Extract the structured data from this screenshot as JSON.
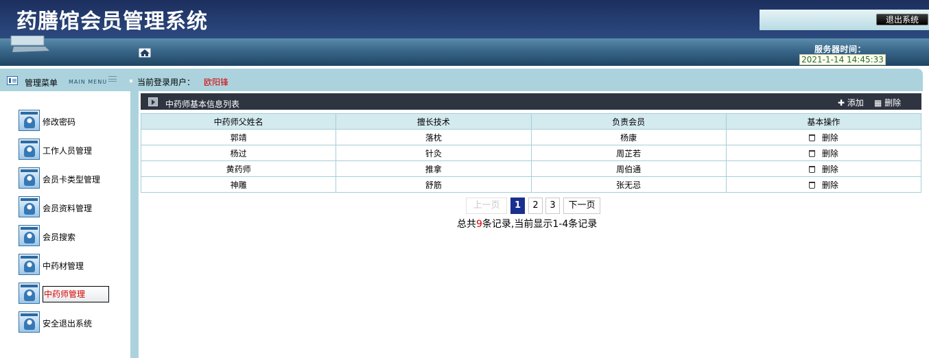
{
  "app": {
    "title": "药膳馆会员管理系统",
    "logout_label": "退出系统",
    "server_time_label": "服务器时间：",
    "server_time_value": "2021-1-14 14:45:33"
  },
  "menu_strip": {
    "title": "管理菜单",
    "subtitle": "MAIN MENU",
    "current_user_label": "当前登录用户：",
    "current_user_name": "欧阳锋"
  },
  "sidebar": {
    "items": [
      {
        "label": "修改密码"
      },
      {
        "label": "工作人员管理"
      },
      {
        "label": "会员卡类型管理"
      },
      {
        "label": "会员资料管理"
      },
      {
        "label": "会员搜索"
      },
      {
        "label": "中药材管理"
      },
      {
        "label": "中药师管理",
        "active": true
      },
      {
        "label": "安全退出系统"
      }
    ]
  },
  "panel": {
    "title": "中药师基本信息列表",
    "add_label": "✚ 添加",
    "delete_label": "▦ 删除"
  },
  "table": {
    "headers": [
      "中药师父姓名",
      "擅长技术",
      "负责会员",
      "基本操作"
    ],
    "rows": [
      {
        "name": "郭靖",
        "skill": "落枕",
        "member": "杨康",
        "action": "删除"
      },
      {
        "name": "杨过",
        "skill": "针灸",
        "member": "周芷若",
        "action": "删除"
      },
      {
        "name": "黄药师",
        "skill": "推拿",
        "member": "周伯通",
        "action": "删除"
      },
      {
        "name": "神雕",
        "skill": "舒筋",
        "member": "张无忌",
        "action": "删除"
      }
    ]
  },
  "pagination": {
    "prev_label": "上一页",
    "pages": [
      "1",
      "2",
      "3"
    ],
    "current_page": "1",
    "next_label": "下一页",
    "summary_prefix": "总共",
    "summary_count": "9",
    "summary_suffix": "条记录,当前显示1-4条记录"
  },
  "colors": {
    "header_bg": "#1c2f5e",
    "menu_strip_bg": "#acd3dd",
    "panel_header_bg": "#2f3540",
    "accent_red": "#d40000",
    "pager_current": "#1a2f8f"
  }
}
